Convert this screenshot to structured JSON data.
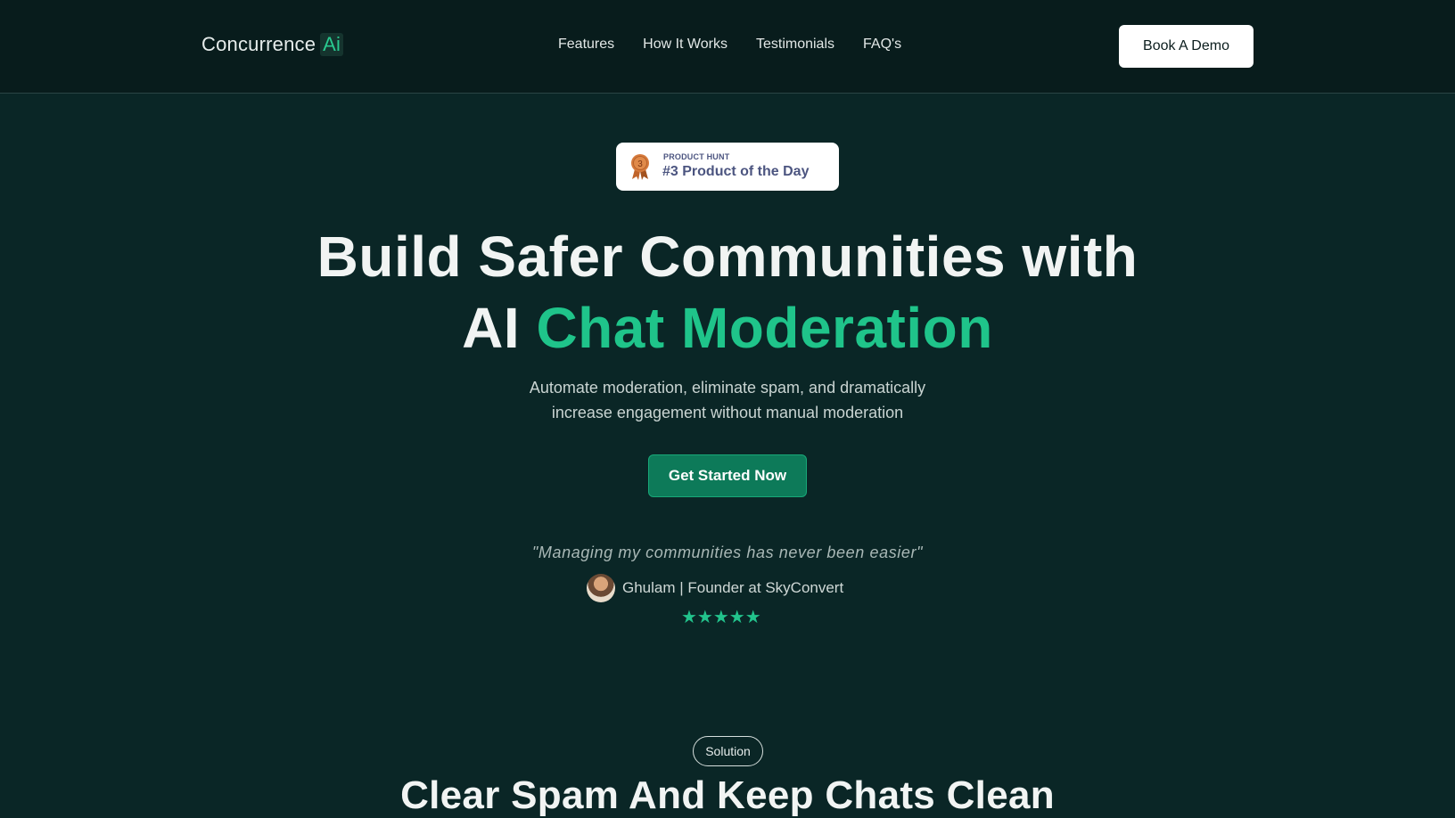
{
  "nav": {
    "logo_text": "Concurrence",
    "logo_accent": "Ai",
    "links": [
      "Features",
      "How It Works",
      "Testimonials",
      "FAQ's"
    ],
    "cta": "Book A Demo"
  },
  "badge": {
    "icon": "medal-icon",
    "rank": "3",
    "small": "PRODUCT HUNT",
    "big": "#3 Product of the Day"
  },
  "hero": {
    "line1": "Build Safer Communities with",
    "line2_prefix": "AI",
    "line2_accent": "Chat Moderation",
    "subtitle_line1": "Automate moderation, eliminate spam, and dramatically",
    "subtitle_line2": "increase engagement without manual moderation",
    "cta": "Get Started Now"
  },
  "testimonial": {
    "quote": "\"Managing my communities has never been easier\"",
    "author": "Ghulam | Founder at SkyConvert",
    "rating": 5,
    "stars": "★★★★★"
  },
  "solution": {
    "pill": "Solution",
    "title": "Clear Spam And Keep Chats Clean"
  },
  "colors": {
    "background": "#0a2626",
    "nav_background": "#081c1c",
    "accent": "#1fc48a",
    "cta": "#0d7a59"
  }
}
